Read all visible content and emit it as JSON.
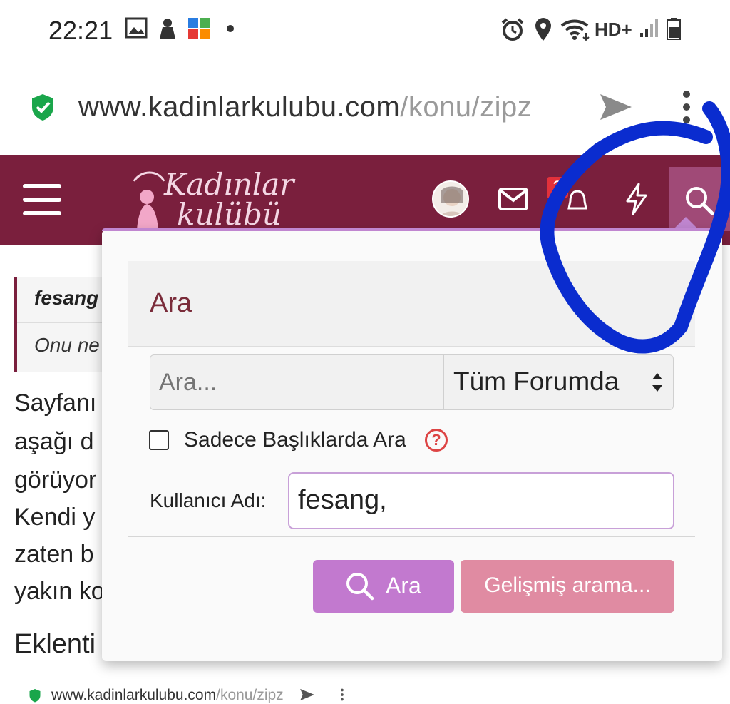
{
  "status_bar": {
    "time": "22:21",
    "network_label": "HD+",
    "icons": [
      "image-icon",
      "notification-icon",
      "app-icon",
      "dot-icon",
      "alarm-icon",
      "location-icon",
      "wifi-icon",
      "signal-icon",
      "battery-icon"
    ]
  },
  "browser": {
    "url_domain": "www.kadinlarkulubu.com",
    "url_path": "/konu/zipz",
    "icons": [
      "secure-shield-icon",
      "send-icon",
      "menu-dots-icon"
    ]
  },
  "site_header": {
    "logo_line1": "Kadınlar",
    "logo_line2": "kulübü",
    "alert_badge": "2",
    "icons": [
      "hamburger-icon",
      "avatar",
      "mail-icon",
      "bell-icon",
      "bolt-icon",
      "search-icon"
    ],
    "colors": {
      "bar": "#7a1f3d",
      "search_tab": "#a04a77"
    }
  },
  "background_page": {
    "quote_author": "fesang",
    "quote_text": "Onu ne",
    "lines": [
      "Sayfanı",
      "aşağı d",
      "görüyor",
      "Kendi y",
      "zaten b",
      "yakın ko"
    ],
    "heading": "Eklenti",
    "mini_url_domain": "www.kadinlarkulubu.com",
    "mini_url_path": "/konu/zipz"
  },
  "search_panel": {
    "title": "Ara",
    "search_placeholder": "Ara...",
    "scope_value": "Tüm Forumda",
    "titles_only_label": "Sadece Başlıklarda Ara",
    "help_glyph": "?",
    "username_label": "Kullanıcı Adı:",
    "username_value": "fesang,",
    "search_button": "Ara",
    "advanced_button": "Gelişmiş arama...",
    "colors": {
      "accent": "#c279cf",
      "advanced": "#e08ba2",
      "title": "#7a2c3a"
    }
  },
  "annotation": {
    "color": "#0a2ccf"
  }
}
